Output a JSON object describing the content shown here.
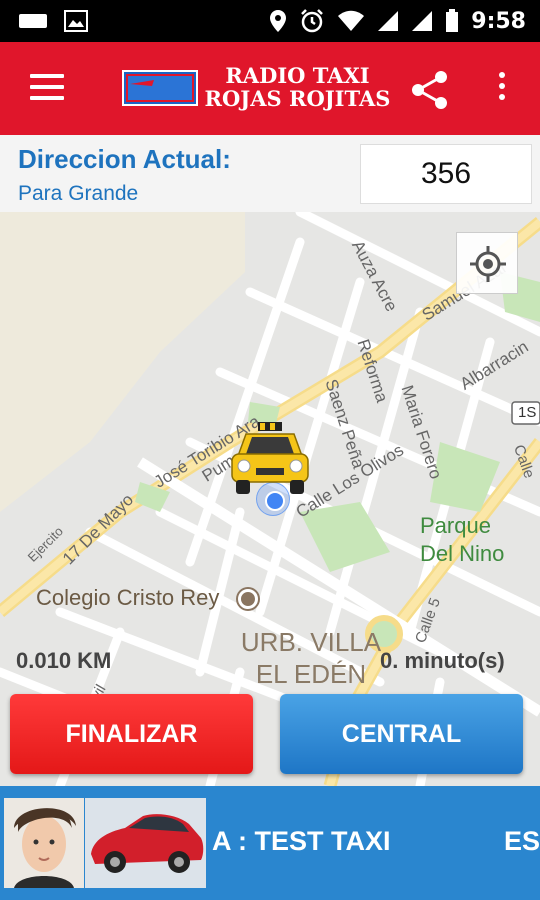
{
  "status_bar": {
    "time": "9:58",
    "icons": [
      "message-icon",
      "image-icon",
      "location-icon",
      "alarm-icon",
      "wifi-icon",
      "signal-icon",
      "signal-icon",
      "battery-icon"
    ]
  },
  "app_bar": {
    "title_line1": "RADIO TAXI",
    "title_line2": "ROJAS ROJITAS",
    "logo_text": "Rojas Rojitas",
    "menu_icon": "hamburger-icon",
    "share_icon": "share-icon",
    "more_icon": "more-vert-icon",
    "color": "#e0162b"
  },
  "address": {
    "label": "Direccion Actual:",
    "value": "Para Grande",
    "unit_number": "356"
  },
  "map": {
    "street_labels": {
      "auza_acre": "Auza Acre",
      "samuel": "Samuel Azar",
      "reforma": "Reforma",
      "albarracin": "Albarracin",
      "saenz_pena": "Saenz Peña",
      "maria_forero": "Maria Forero",
      "jose_toribio": "José Toribio Ara",
      "pum": "Pum",
      "calle_los_olivos": "Calle Los Olivos",
      "diecisiete_mayo": "17 De Mayo",
      "ejercito": "Ejercito",
      "calle_5": "Calle 5",
      "civil": "Civil",
      "calle_edge": "Calle",
      "route": "1S"
    },
    "places": {
      "school": "Colegio Cristo Rey",
      "park_line1": "Parque",
      "park_line2": "Del Nino",
      "urb_line1": "URB. VILLA",
      "urb_line2": "EL EDÉN"
    },
    "distance": "0.010 KM",
    "duration": "0. minuto(s)",
    "locate_icon": "my-location-icon"
  },
  "actions": {
    "finish_label": "FINALIZAR",
    "central_label": "CENTRAL"
  },
  "banner": {
    "ticker_text": "A : TEST TAXI",
    "ticker_next": "ES"
  }
}
